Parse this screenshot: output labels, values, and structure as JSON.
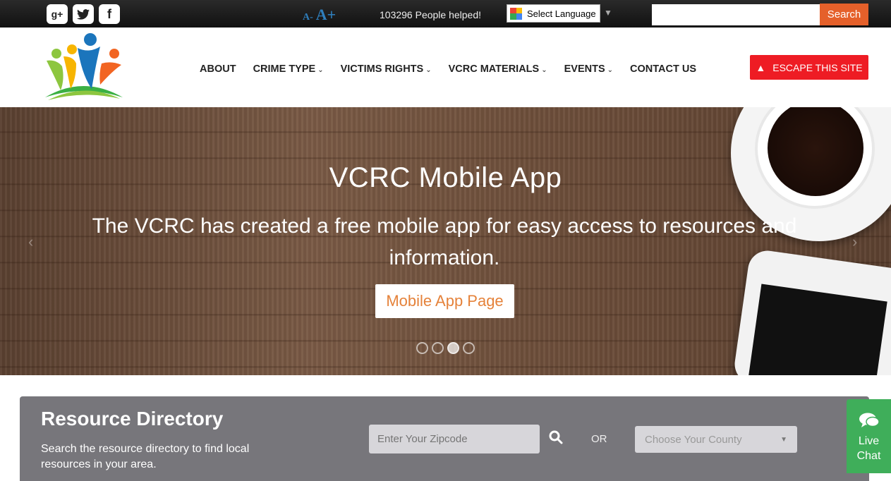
{
  "topbar": {
    "social": [
      {
        "name": "google-plus",
        "glyph": "g+"
      },
      {
        "name": "twitter",
        "glyph": "🐦"
      },
      {
        "name": "facebook",
        "glyph": "f"
      }
    ],
    "font_decrease": "A-",
    "font_increase": "A+",
    "people_helped": "103296 People helped!",
    "language_select": "Select Language",
    "search_button": "Search",
    "search_placeholder": ""
  },
  "nav": {
    "items": [
      {
        "label": "ABOUT",
        "dropdown": false
      },
      {
        "label": "CRIME TYPE",
        "dropdown": true
      },
      {
        "label": "VICTIMS RIGHTS",
        "dropdown": true
      },
      {
        "label": "VCRC MATERIALS",
        "dropdown": true
      },
      {
        "label": "EVENTS",
        "dropdown": true
      },
      {
        "label": "CONTACT US",
        "dropdown": false
      }
    ],
    "escape_button": "ESCAPE THIS SITE"
  },
  "hero": {
    "title": "VCRC Mobile App",
    "text": "The VCRC has created a free mobile app for easy access to resources and information.",
    "button": "Mobile App Page",
    "slide_count": 4,
    "active_slide": 3
  },
  "resource_directory": {
    "title": "Resource Directory",
    "description": "Search the resource directory to find local resources in your area.",
    "zip_placeholder": "Enter Your Zipcode",
    "or_label": "OR",
    "county_placeholder": "Choose Your County"
  },
  "live_chat": {
    "line1": "Live",
    "line2": "Chat"
  },
  "colors": {
    "accent_orange": "#e5602a",
    "escape_red": "#ee1c24",
    "chat_green": "#3fae5a",
    "directory_gray": "#77767b"
  }
}
